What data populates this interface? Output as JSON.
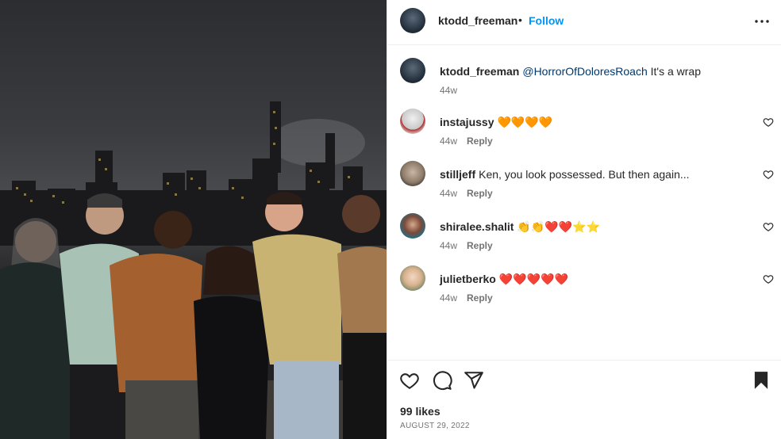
{
  "post": {
    "username": "ktodd_freeman",
    "separator": "•",
    "follow_label": "Follow",
    "caption": {
      "username": "ktodd_freeman",
      "mention": "@HorrorOfDoloresRoach",
      "text": " It's a wrap",
      "time": "44w"
    },
    "likes": "99 likes",
    "date": "AUGUST 29, 2022"
  },
  "comments": [
    {
      "username": "instajussy",
      "text": "🧡🧡🧡🧡",
      "time": "44w",
      "reply": "Reply"
    },
    {
      "username": "stilljeff",
      "text": "Ken, you look possessed. But then again...",
      "time": "44w",
      "reply": "Reply"
    },
    {
      "username": "shiralee.shalit",
      "text": "👏👏❤️❤️⭐⭐",
      "time": "44w",
      "reply": "Reply"
    },
    {
      "username": "julietberko",
      "text": "❤️❤️❤️❤️❤️",
      "time": "44w",
      "reply": "Reply"
    }
  ],
  "icons": {
    "more": "more-options-icon",
    "like": "heart-icon",
    "comment": "comment-icon",
    "share": "share-icon",
    "save": "bookmark-icon"
  },
  "colors": {
    "accent": "#0095f6",
    "mention": "#00376b",
    "muted": "#737373",
    "border": "#efefef"
  }
}
